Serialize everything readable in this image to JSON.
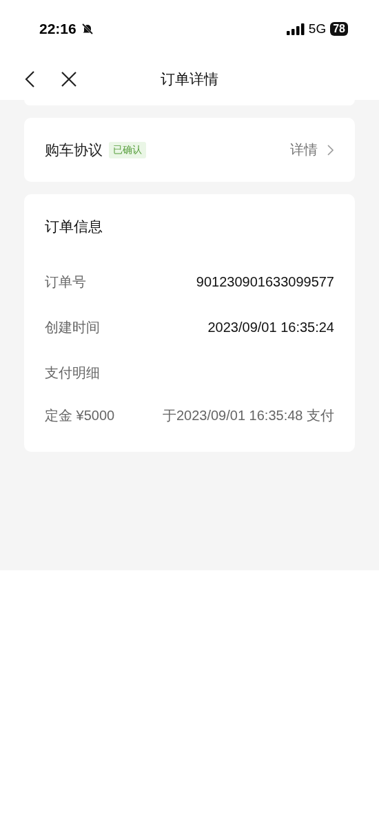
{
  "status_bar": {
    "time": "22:16",
    "network": "5G",
    "battery": "78"
  },
  "nav_bar": {
    "title": "订单详情"
  },
  "agreement": {
    "label": "购车协议",
    "badge": "已确认",
    "link": "详情"
  },
  "order_info": {
    "title": "订单信息",
    "rows": [
      {
        "kind": "field",
        "label": "订单号",
        "value": "901230901633099577"
      },
      {
        "kind": "field",
        "label": "创建时间",
        "value": "2023/09/01 16:35:24"
      },
      {
        "kind": "heading",
        "label": "支付明细"
      },
      {
        "kind": "payment",
        "label": "定金 ¥5000",
        "value": "于2023/09/01 16:35:48 支付"
      }
    ]
  }
}
